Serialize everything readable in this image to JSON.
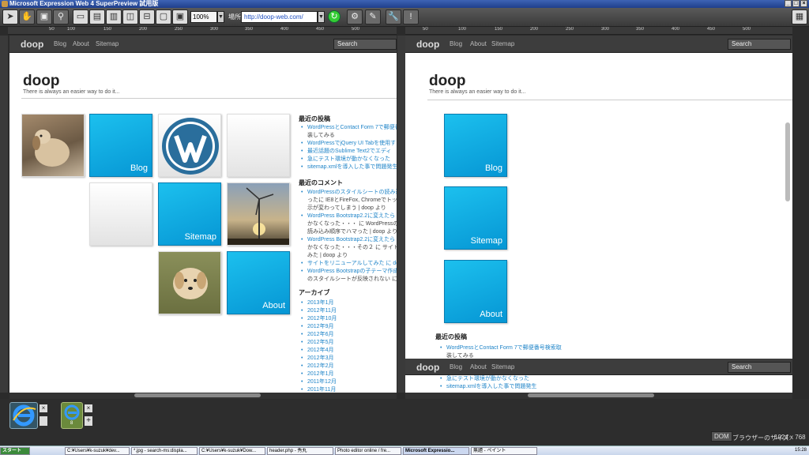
{
  "window": {
    "title": "Microsoft Expression Web 4 SuperPreview 試用版"
  },
  "toolbar": {
    "zoom": "100%",
    "location_label": "場所",
    "url": "http://doop-web.com/"
  },
  "ruler_left": [
    "50",
    "100",
    "150",
    "200",
    "250",
    "300",
    "350",
    "400",
    "450",
    "500"
  ],
  "ruler_right": [
    "50",
    "100",
    "150",
    "200",
    "250",
    "300",
    "350",
    "400",
    "450",
    "500"
  ],
  "site": {
    "brand": "doop",
    "nav": [
      "Blog",
      "About",
      "Sitemap"
    ],
    "search": "Search",
    "title": "doop",
    "tagline": "There is always an easier way to do it..."
  },
  "tiles": {
    "blog": "Blog",
    "sitemap": "Sitemap",
    "about": "About"
  },
  "sidebar": {
    "recent_posts_heading": "最近の投稿",
    "recent_posts": [
      "WordPressとContact Form 7で郵便番",
      "装してみる",
      "WordPressでjQuery UI Tabを使用す",
      "最近話題のSublime Text2でエディ",
      "急にテスト環境が動かなくなった",
      "sitemap.xmlを導入した事で問題発生"
    ],
    "recent_comments_heading": "最近のコメント",
    "recent_comments": [
      "WordPressのスタイルシートの読み込",
      "ったに IE8とFireFox, Chromeでトッ",
      "示が変わってしまう | doop より",
      "WordPress Bootstrap2.2に変えたら",
      "かなくなった・・・ に WordPressのスタ",
      "読み込み順序でハマった | doop より",
      "WordPress Bootstrap2.2に変えたら",
      "かなくなった・・・その２ に サイトをリニ",
      "みた | doop より",
      "サイトをリニューアルしてみた に doop",
      "WordPress Bootstrapの子テーマ作成",
      "のスタイルシートが反映されない に doo"
    ],
    "archive_heading": "アーカイブ",
    "archives": [
      "2013年1月",
      "2012年11月",
      "2012年10月",
      "2012年9月",
      "2012年6月",
      "2012年5月",
      "2012年4月",
      "2012年3月",
      "2012年2月",
      "2012年1月",
      "2011年12月",
      "2011年11月"
    ]
  },
  "right_pane": {
    "recent_posts_heading": "最近の投稿",
    "recent_posts": [
      "WordPressとContact Form 7で郵便番号検索取",
      "装してみる"
    ],
    "bottom_posts": [
      "急にテスト環境が動かなくなった",
      "sitemap.xmlを導入した事で問題発生"
    ]
  },
  "status": {
    "dom": "DOM",
    "browser_size_label": "ブラウザーのサイズ:",
    "browser_size": "1024 x 768"
  },
  "thumb": {
    "count": "8"
  },
  "taskbar": {
    "start": "スタート",
    "tasks": [
      "C:¥Users¥k-suzuk¥dev...",
      "*.jpg - search-ms:displa...",
      "C:¥Users¥k-suzuk¥Dow...",
      "header.php - 秀丸",
      "Photo editor online / fre...",
      "Microsoft Expressio...",
      "無題 - ペイント"
    ],
    "clock": "15:28"
  },
  "colors": {
    "accent": "#1cc0ee",
    "link": "#1f84c8",
    "navbar": "#3d3d3d"
  }
}
